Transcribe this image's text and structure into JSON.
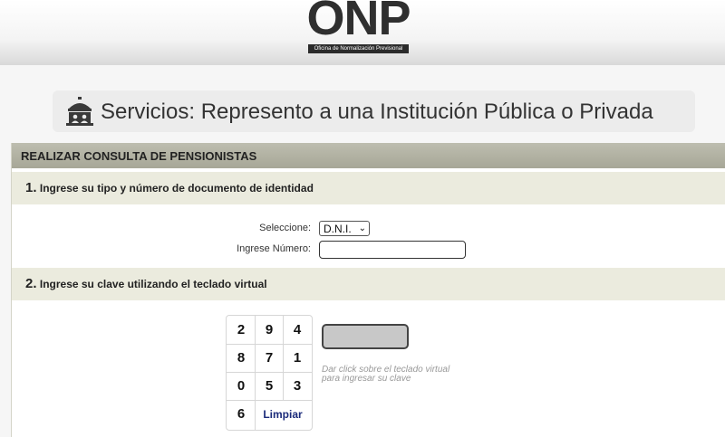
{
  "header": {
    "logo_text": "ONP",
    "logo_subtitle": "Oficina de Normalización Previsional"
  },
  "page": {
    "title": "Servicios: Represento a una Institución Pública o Privada",
    "title_icon": "institution-building-icon"
  },
  "form": {
    "heading": "REALIZAR CONSULTA DE PENSIONISTAS",
    "step1": {
      "number": "1.",
      "label": "Ingrese su tipo y número de documento de identidad"
    },
    "select_label": "Seleccione:",
    "select_value": "D.N.I.",
    "number_label": "Ingrese Número:",
    "number_value": "",
    "step2": {
      "number": "2.",
      "label": "Ingrese su clave utilizando el teclado virtual"
    },
    "keypad": {
      "keys": [
        "2",
        "9",
        "4",
        "8",
        "7",
        "1",
        "0",
        "5",
        "3",
        "6"
      ],
      "clear_label": "Limpiar"
    },
    "password_value": "",
    "hint_line1": "Dar click sobre el teclado virtual",
    "hint_line2": "para ingresar su clave"
  },
  "colors": {
    "panel_header": "#b2b2a3",
    "step_band": "#ebebde",
    "clear_text": "#1a2a7a"
  }
}
